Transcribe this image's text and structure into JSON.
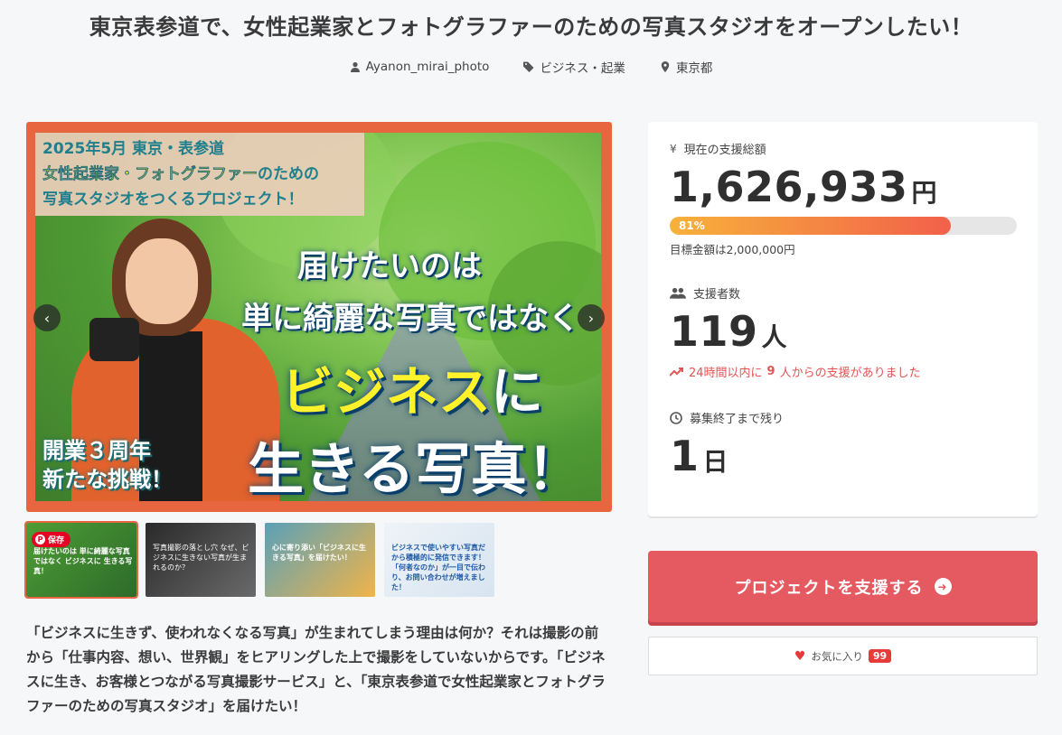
{
  "project": {
    "title": "東京表参道で、女性起業家とフォトグラファーのための写真スタジオをオープンしたい！",
    "owner": "Ayanon_mirai_photo",
    "category": "ビジネス・起業",
    "location": "東京都"
  },
  "hero": {
    "caption_line1": "2025年5月 東京・表参道",
    "caption_line2_highlight": "女性起業家・フォトグラファー",
    "caption_line2_rest": "のための",
    "caption_line3": "写真スタジオをつくるプロジェクト！",
    "headline1": "届けたいのは",
    "headline2": "単に綺麗な写真ではなく",
    "headline3_highlight": "ビジネス",
    "headline3_rest": "に",
    "headline4": "生きる写真！",
    "badge_line1": "開業３周年",
    "badge_line2": "新たな挑戦！",
    "prev_icon": "‹",
    "next_icon": "›"
  },
  "thumbnails": [
    {
      "text": "届けたいのは 単に綺麗な写真ではなく ビジネスに 生きる写真！",
      "save_label": "保存"
    },
    {
      "text": "写真撮影の落とし穴 なぜ、ビジネスに生きない写真が生まれるのか？"
    },
    {
      "text": "心に寄り添い「ビジネスに生きる写真」を届けたい！"
    },
    {
      "text": "ビジネスで使いやすい写真だから積極的に発信できます！「何者なのか」が一目で伝わり、お問い合わせが増えました！"
    }
  ],
  "description": "「ビジネスに生きず、使われなくなる写真」が生まれてしまう理由は何か？それは撮影の前から「仕事内容、想い、世界観」をヒアリングした上で撮影をしていないからです。「ビジネスに生き、お客様とつながる写真撮影サービス」と、「東京表参道で女性起業家とフォトグラファーのための写真スタジオ」を届けたい！",
  "stats": {
    "total_label": "現在の支援総額",
    "total_value": "1,626,933",
    "total_unit": "円",
    "progress_percent": 81,
    "progress_label": "81%",
    "goal_text": "目標金額は2,000,000円",
    "supporters_label": "支援者数",
    "supporters_value": "119",
    "supporters_unit": "人",
    "trend_prefix": "24時間以内に",
    "trend_count": "9",
    "trend_suffix": "人からの支援がありました",
    "remaining_label": "募集終了まで残り",
    "remaining_value": "1",
    "remaining_unit": "日"
  },
  "actions": {
    "support_label": "プロジェクトを支援する",
    "favorite_label": "お気に入り",
    "favorite_count": "99"
  },
  "colors": {
    "accent_red": "#e55961",
    "progress_start": "#f7b23b",
    "progress_end": "#f2604a",
    "hero_border": "#e8663f"
  }
}
